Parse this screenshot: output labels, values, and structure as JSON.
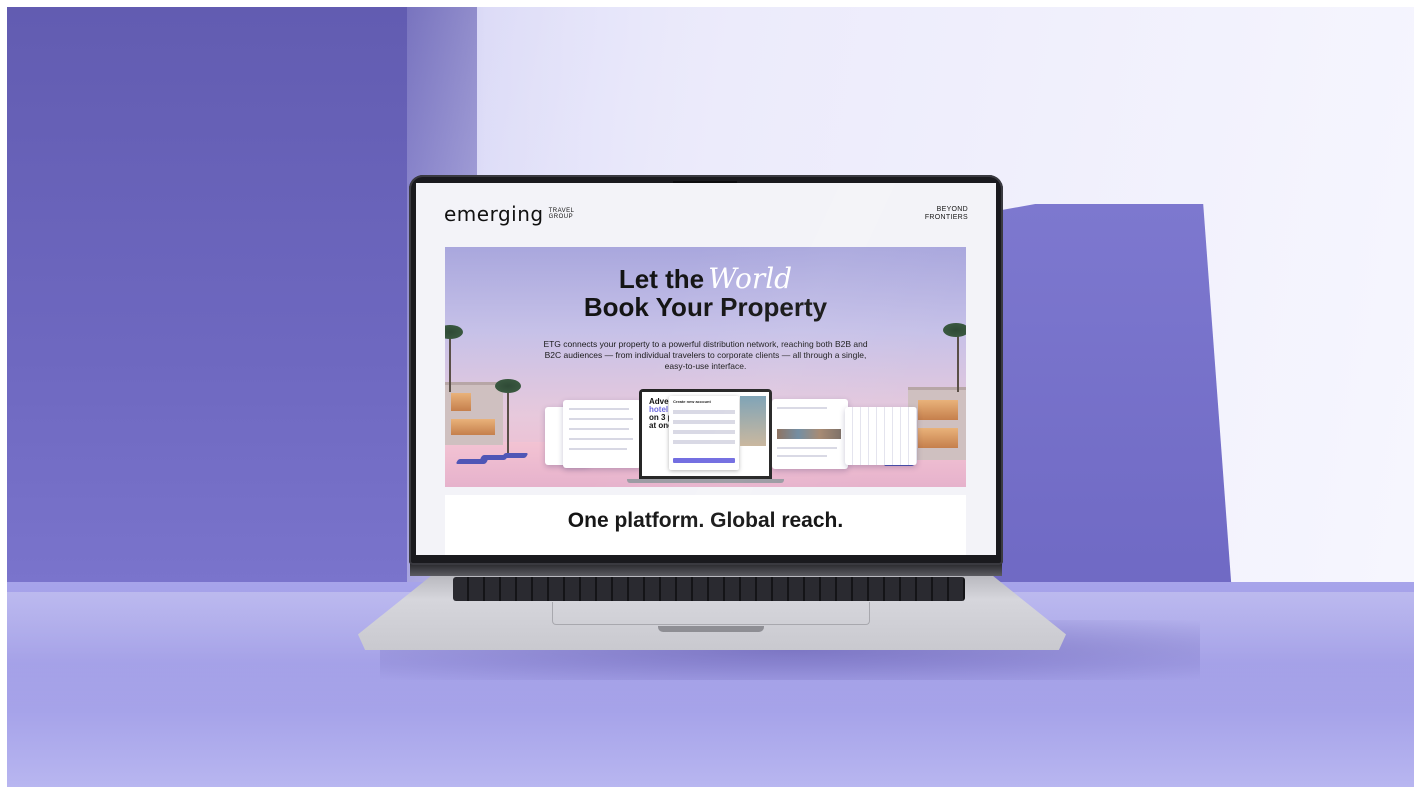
{
  "site": {
    "logo_word": "emerging",
    "logo_sub_line1": "TRAVEL",
    "logo_sub_line2": "GROUP",
    "tagline_line1": "BEYOND",
    "tagline_line2": "FRONTIERS"
  },
  "hero": {
    "title_part1": "Let the",
    "title_script": "World",
    "title_line2": "Book Your Property",
    "description": "ETG connects your property to a powerful distribution network, reaching both B2B and B2C audiences — from individual travelers to corporate clients — all through a single, easy-to-use interface.",
    "mock_left_line1": "Adve",
    "mock_left_line2": "hotel",
    "mock_left_line3": "on 3 p",
    "mock_left_line4": "at onc",
    "mock_modal_title": "Create new account"
  },
  "section": {
    "title": "One platform. Global reach."
  },
  "colors": {
    "accent": "#6f6ae0",
    "background_purple": "#6a64b8",
    "floor": "#a7a4ea"
  }
}
